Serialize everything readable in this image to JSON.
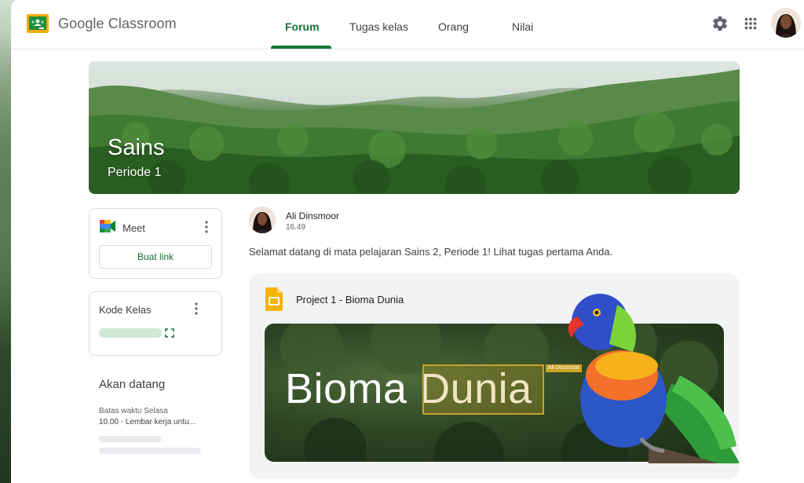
{
  "app": {
    "brand_name": "Google Classroom",
    "accent_color": "#137333"
  },
  "nav": {
    "tabs": [
      {
        "label": "Forum",
        "active": true
      },
      {
        "label": "Tugas kelas",
        "active": false
      },
      {
        "label": "Orang",
        "active": false
      },
      {
        "label": "Nilai",
        "active": false
      }
    ],
    "icons": [
      "gear-icon",
      "apps-grid-icon",
      "account-avatar"
    ]
  },
  "banner": {
    "title": "Sains",
    "subtitle": "Periode 1"
  },
  "meet_card": {
    "label": "Meet",
    "button_label": "Buat link"
  },
  "class_code_card": {
    "label": "Kode Kelas"
  },
  "upcoming": {
    "title": "Akan datang",
    "due_label": "Batas waktu Selasa",
    "item": "10.00 - Lembar kerja untu..."
  },
  "post": {
    "author": "Ali Dinsmoor",
    "time": "16.49",
    "text": "Selamat datang di mata pelajaran Sains 2, Periode 1! Lihat tugas pertama Anda.",
    "attachment": {
      "title": "Project 1 - Bioma Dunia",
      "preview_word1": "Bioma",
      "preview_word2": "Dunia",
      "selection_tag": "Ali Dinsmoor"
    }
  }
}
